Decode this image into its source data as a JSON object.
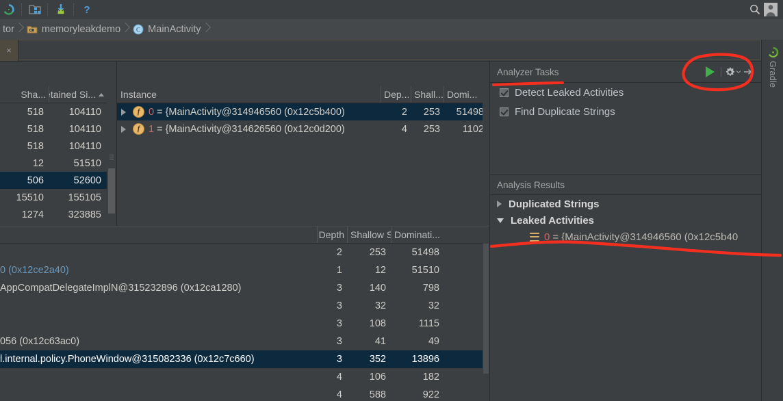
{
  "toolbar": {
    "icons": [
      "android-studio-sync-icon",
      "project-structure-icon",
      "avd-download-icon",
      "help-icon"
    ],
    "search_icon": "search-icon",
    "avatar": "user-avatar-icon"
  },
  "breadcrumb": {
    "items": [
      {
        "label": "tor",
        "icon": ""
      },
      {
        "label": "memoryleakdemo",
        "icon": "folder-icon"
      },
      {
        "label": "MainActivity",
        "icon": "class-icon"
      }
    ]
  },
  "editor_tab": {
    "close_label": "×"
  },
  "class_table": {
    "headers": [
      {
        "label": "Sha...",
        "sorted": false
      },
      {
        "label": "Retained Si...",
        "sorted": true,
        "sort_dir": "asc"
      }
    ],
    "rows": [
      {
        "shallow": "518",
        "retained": "104110",
        "selected": false
      },
      {
        "shallow": "518",
        "retained": "104110",
        "selected": false
      },
      {
        "shallow": "518",
        "retained": "104110",
        "selected": false
      },
      {
        "shallow": "12",
        "retained": "51510",
        "selected": false
      },
      {
        "shallow": "506",
        "retained": "52600",
        "selected": true
      },
      {
        "shallow": "15510",
        "retained": "155105",
        "selected": false
      },
      {
        "shallow": "1274",
        "retained": "323885",
        "selected": false
      }
    ]
  },
  "instance_table": {
    "headers": [
      "Instance",
      "Dep...",
      "Shall...",
      "Domi..."
    ],
    "rows": [
      {
        "expander": "chevron-right",
        "badge": "f",
        "index": "0",
        "name": "= {MainActivity@314946560 (0x12c5b400)",
        "depth": "2",
        "shallow": "253",
        "dominating": "51498",
        "selected": true
      },
      {
        "expander": "chevron-right",
        "badge": "f",
        "index": "1",
        "name": "= {MainActivity@314626560 (0x12c0d200)",
        "depth": "4",
        "shallow": "253",
        "dominating": "1102",
        "selected": false
      }
    ]
  },
  "reference_table": {
    "headers": [
      "",
      "Depth",
      "Shallow Si...",
      "Dominati..."
    ],
    "rows": [
      {
        "name": "",
        "blue": false,
        "depth": "2",
        "shallow": "253",
        "dominating": "51498",
        "selected": false
      },
      {
        "name": "0 (0x12ce2a40)",
        "blue": true,
        "depth": "1",
        "shallow": "12",
        "dominating": "51510",
        "selected": false
      },
      {
        "name": "AppCompatDelegateImplN@315232896 (0x12ca1280)",
        "blue": false,
        "depth": "3",
        "shallow": "140",
        "dominating": "798",
        "selected": false
      },
      {
        "name": "",
        "blue": false,
        "depth": "3",
        "shallow": "32",
        "dominating": "32",
        "selected": false
      },
      {
        "name": "",
        "blue": false,
        "depth": "3",
        "shallow": "108",
        "dominating": "1115",
        "selected": false
      },
      {
        "name": "056 (0x12c63ac0)",
        "blue": false,
        "depth": "3",
        "shallow": "41",
        "dominating": "49",
        "selected": false
      },
      {
        "name": "l.internal.policy.PhoneWindow@315082336 (0x12c7c660)",
        "blue": false,
        "depth": "3",
        "shallow": "352",
        "dominating": "13896",
        "selected": true
      },
      {
        "name": "",
        "blue": false,
        "depth": "4",
        "shallow": "106",
        "dominating": "182",
        "selected": false
      },
      {
        "name": "",
        "blue": false,
        "depth": "4",
        "shallow": "588",
        "dominating": "922",
        "selected": false
      }
    ]
  },
  "analyzer_tasks": {
    "title": "Analyzer Tasks",
    "run_icon": "play-icon",
    "settings_icon": "gear-icon",
    "hide_icon": "hide-panel-icon",
    "tasks": [
      {
        "label": "Detect Leaked Activities",
        "checked": true
      },
      {
        "label": "Find Duplicate Strings",
        "checked": true
      }
    ]
  },
  "analysis_results": {
    "title": "Analysis Results",
    "nodes": [
      {
        "label": "Duplicated Strings",
        "expanded": false,
        "type": "group"
      },
      {
        "label": "Leaked Activities",
        "expanded": true,
        "type": "group"
      },
      {
        "index": "0",
        "label": "= {MainActivity@314946560 (0x12c5b40",
        "type": "leaf",
        "icon": "stack-icon"
      }
    ]
  },
  "right_tool_bar": {
    "gradle_label": "Gradle",
    "gradle_icon": "gradle-icon"
  },
  "colors": {
    "background": "#3c3f41",
    "selection": "#0d293e",
    "accent_green": "#3fb14b",
    "annotation_red": "#f52f1f",
    "link_blue": "#6897bb",
    "index_red": "#cc6666",
    "badge_amber": "#e8b76a"
  },
  "annotations": {
    "circle_label": "red-circle-highlight-run-controls",
    "underline_tasks": "red-underline-analyzer-tasks",
    "underline_result": "red-underline-leaked-activity-row"
  }
}
